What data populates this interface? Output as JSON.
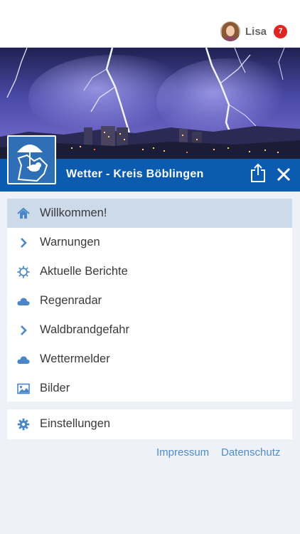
{
  "user": {
    "name": "Lisa",
    "notifications": "7"
  },
  "header": {
    "title": "Wetter - Kreis Böblingen"
  },
  "menu": {
    "items": [
      {
        "label": "Willkommen!",
        "icon": "home-icon"
      },
      {
        "label": "Warnungen",
        "icon": "chevron-right-icon"
      },
      {
        "label": "Aktuelle Berichte",
        "icon": "sun-outline-icon"
      },
      {
        "label": "Regenradar",
        "icon": "cloud-icon"
      },
      {
        "label": "Waldbrandgefahr",
        "icon": "chevron-right-icon"
      },
      {
        "label": "Wettermelder",
        "icon": "cloud-icon"
      },
      {
        "label": "Bilder",
        "icon": "image-icon"
      }
    ],
    "settings": {
      "label": "Einstellungen",
      "icon": "gear-icon"
    }
  },
  "footer": {
    "impressum": "Impressum",
    "datenschutz": "Datenschutz"
  },
  "colors": {
    "accent": "#0b5bb0",
    "active_row": "#ccdaea",
    "icon": "#4a86c8",
    "badge": "#e2231f",
    "background": "#eef2f8",
    "link": "#4f8cc9"
  }
}
